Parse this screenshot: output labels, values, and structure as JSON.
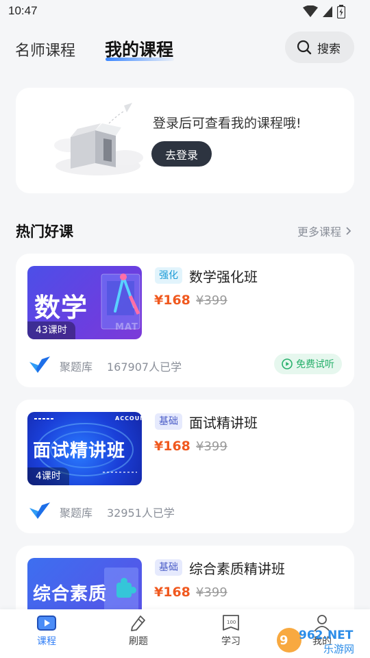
{
  "status_bar": {
    "time": "10:47"
  },
  "header": {
    "tab_teacher": "名师课程",
    "tab_mine": "我的课程",
    "search_label": "搜索"
  },
  "login_card": {
    "prompt": "登录后可查看我的课程哦!",
    "button": "去登录"
  },
  "hot_section": {
    "title": "热门好课",
    "more": "更多课程"
  },
  "courses": [
    {
      "thumb_title": "数学",
      "thumb_sub": "MAT",
      "hours": "43课时",
      "tag": "强化",
      "name": "数学强化班",
      "price": "¥168",
      "original_price": "¥399",
      "provider": "聚题库",
      "learners": "167907人已学",
      "trial": "免费试听"
    },
    {
      "thumb_title": "面试精讲班",
      "thumb_badge": "ACCOUNT",
      "hours": "4课时",
      "tag": "基础",
      "name": "面试精讲班",
      "price": "¥168",
      "original_price": "¥399",
      "provider": "聚题库",
      "learners": "32951人已学"
    },
    {
      "thumb_title": "综合素质",
      "tag": "基础",
      "name": "综合素质精讲班",
      "price": "¥168",
      "original_price": "¥399"
    }
  ],
  "bottom_nav": [
    {
      "label": "课程",
      "icon": "play-icon",
      "active": true
    },
    {
      "label": "刷题",
      "icon": "pencil-icon",
      "active": false
    },
    {
      "label": "学习",
      "icon": "book-icon",
      "active": false
    },
    {
      "label": "我的",
      "icon": "user-icon",
      "active": false
    }
  ],
  "watermark": {
    "text": "962.NET",
    "sub": "乐游网"
  },
  "colors": {
    "accent": "#2f7df6",
    "price": "#f0591f",
    "trial_green": "#27b06b",
    "login_button": "#2d3440"
  }
}
